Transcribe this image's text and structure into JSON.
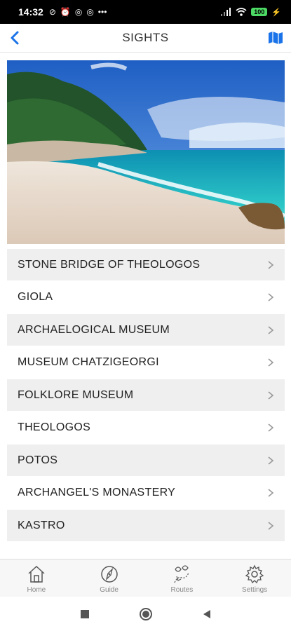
{
  "status_bar": {
    "time": "14:32",
    "battery": "100",
    "more": "•••"
  },
  "header": {
    "title": "SIGHTS",
    "back_icon": "chevron-left-icon",
    "map_icon": "map-icon",
    "accent_color": "#1a73e8"
  },
  "hero_image": {
    "subject": "beach with turquoise sea and pine-covered hill"
  },
  "sights": [
    {
      "label": "STONE BRIDGE OF THEOLOGOS"
    },
    {
      "label": "GIOLA"
    },
    {
      "label": "ARCHAELOGICAL MUSEUM"
    },
    {
      "label": "MUSEUM CHATZIGEORGI"
    },
    {
      "label": "FOLKLORE MUSEUM"
    },
    {
      "label": "THEOLOGOS"
    },
    {
      "label": "POTOS"
    },
    {
      "label": "ARCHANGEL'S MONASTERY"
    },
    {
      "label": "KASTRO"
    }
  ],
  "tabs": [
    {
      "label": "Home",
      "icon": "home-icon"
    },
    {
      "label": "Guide",
      "icon": "compass-icon"
    },
    {
      "label": "Routes",
      "icon": "routes-icon"
    },
    {
      "label": "Settings",
      "icon": "gear-icon"
    }
  ]
}
